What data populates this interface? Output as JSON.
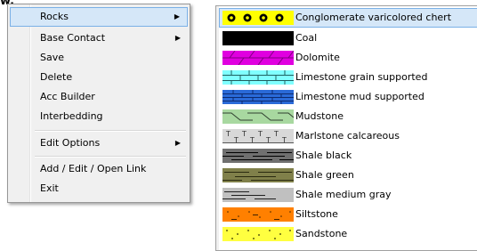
{
  "corner_text": "w.",
  "menu": {
    "items": [
      {
        "label": "Rocks",
        "arrow": "▶",
        "highlighted": true
      },
      {
        "label": "Base Contact",
        "arrow": "▶"
      },
      {
        "label": "Save"
      },
      {
        "label": "Delete"
      },
      {
        "label": "Acc Builder"
      },
      {
        "label": "Interbedding"
      },
      {
        "label": "Edit Options",
        "arrow": "▶"
      },
      {
        "label": "Add / Edit / Open Link"
      },
      {
        "label": "Exit"
      }
    ]
  },
  "rocks": {
    "items": [
      {
        "label": "Conglomerate varicolored chert",
        "pattern": "conglomerate-pattern",
        "highlighted": true
      },
      {
        "label": "Coal",
        "pattern": "coal-pattern"
      },
      {
        "label": "Dolomite",
        "pattern": "dolomite-pattern"
      },
      {
        "label": "Limestone grain supported",
        "pattern": "limestone-grain-pattern"
      },
      {
        "label": "Limestone mud supported",
        "pattern": "limestone-mud-pattern"
      },
      {
        "label": "Mudstone",
        "pattern": "mudstone-pattern"
      },
      {
        "label": "Marlstone calcareous",
        "pattern": "marlstone-pattern"
      },
      {
        "label": "Shale black",
        "pattern": "shale-black-pattern"
      },
      {
        "label": "Shale green",
        "pattern": "shale-green-pattern"
      },
      {
        "label": "Shale medium gray",
        "pattern": "shale-gray-pattern"
      },
      {
        "label": "Siltstone",
        "pattern": "siltstone-pattern"
      },
      {
        "label": "Sandstone",
        "pattern": "sandstone-pattern"
      }
    ]
  },
  "colors": {
    "highlight_fill": "#d5e7f8",
    "highlight_border": "#7ab0e6",
    "menu_bg": "#f0f0f0",
    "conglomerate": "#ffff00",
    "coal": "#000000",
    "dolomite": "#e000e0",
    "limestone_grain": "#80ffff",
    "limestone_mud": "#2a6ad8",
    "mudstone": "#a8d8a0",
    "shale_black": "#707070",
    "shale_green": "#80804a",
    "shale_gray": "#c0c0c0",
    "siltstone": "#ff8000",
    "sandstone": "#ffff40"
  }
}
